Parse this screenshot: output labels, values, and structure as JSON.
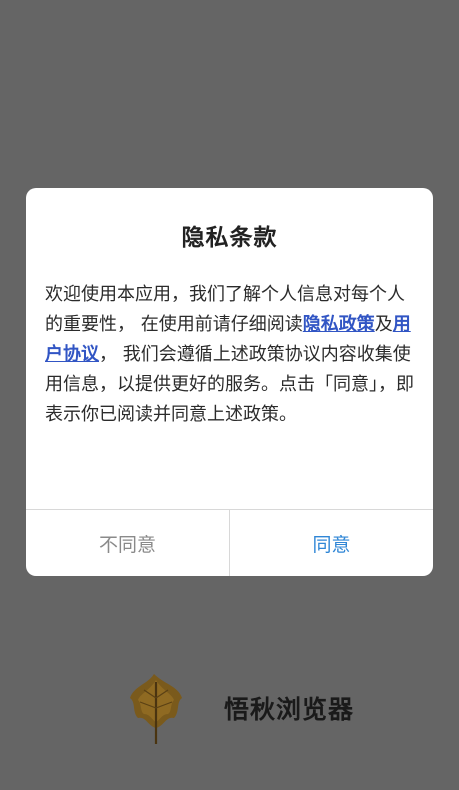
{
  "splash": {
    "app_name": "悟秋浏览器",
    "logo_icon": "maple-leaf-icon"
  },
  "dialog": {
    "title": "隐私条款",
    "body_part1": "欢迎使用本应用，我们了解个人信息对每个人的重要性， 在使用前请仔细阅读",
    "privacy_policy_link": "隐私政策",
    "connector": "及",
    "user_agreement_link": "用户协议",
    "body_part2": "， 我们会遵循上述政策协议内容收集使用信息，以提供更好的服务。点击「同意」，即表示你已阅读并同意上述政策。",
    "disagree_label": "不同意",
    "agree_label": "同意"
  },
  "colors": {
    "overlay": "#656565",
    "link": "#3155c4",
    "agree": "#2f86d6",
    "disagree": "#8a8a8a"
  }
}
